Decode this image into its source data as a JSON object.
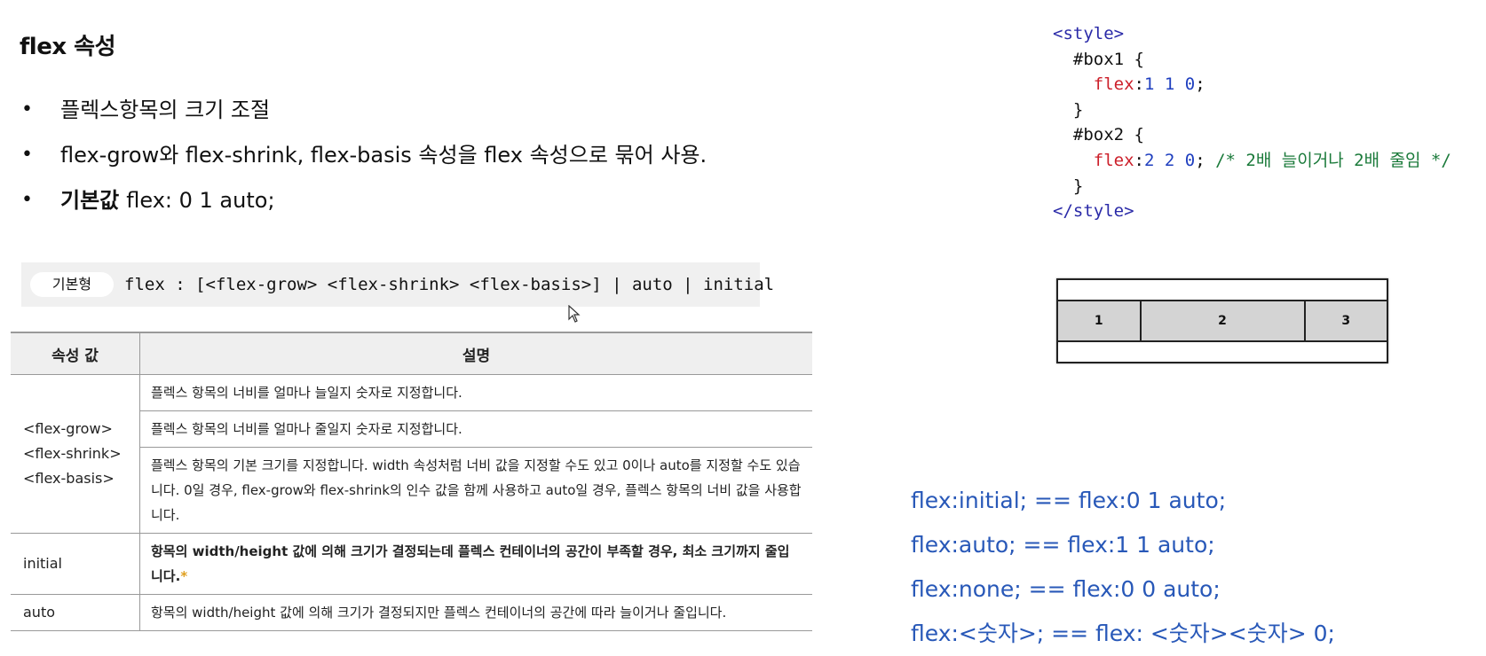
{
  "title": "flex 속성",
  "bullets": [
    {
      "dot": "•",
      "strong": "",
      "text": "플렉스항목의 크기 조절"
    },
    {
      "dot": "•",
      "strong": "",
      "text": "flex-grow와 flex-shrink, flex-basis 속성을 flex 속성으로 묶어 사용."
    },
    {
      "dot": "•",
      "strong": "기본값",
      "text": "flex: 0 1 auto;"
    }
  ],
  "syntax": {
    "label": "기본형",
    "code": "flex : [<flex-grow> <flex-shrink> <flex-basis>]  | auto | initial"
  },
  "table": {
    "headers": [
      "속성 값",
      "설명"
    ],
    "group_label_lines": [
      "<flex-grow>",
      "<flex-shrink>",
      "<flex-basis>"
    ],
    "group_rows": [
      "플렉스 항목의 너비를 얼마나 늘일지 숫자로 지정합니다.",
      "플렉스 항목의 너비를 얼마나 줄일지 숫자로 지정합니다.",
      "플렉스 항목의 기본 크기를 지정합니다. width 속성처럼 너비 값을 지정할 수도 있고 0이나 auto를 지정할 수도 있습니다. 0일 경우, flex-grow와 flex-shrink의 인수 값을 함께 사용하고 auto일 경우, 플렉스 항목의 너비 값을 사용합니다."
    ],
    "initial": {
      "label": "initial",
      "desc": "항목의 width/height 값에 의해 크기가 결정되는데 플렉스 컨테이너의 공간이 부족할 경우, 최소 크기까지 줄입니다.",
      "mark": "*"
    },
    "auto": {
      "label": "auto",
      "desc": "항목의 width/height 값에 의해 크기가 결정되지만 플렉스 컨테이너의 공간에 따라 늘이거나 줄입니다."
    }
  },
  "code": {
    "style_open": "<style>",
    "box1_sel": "#box1 {",
    "box1_prop": "flex",
    "box1_colon": ":",
    "box1_val": "1 1 0",
    "box1_semi": ";",
    "close1": "}",
    "box2_sel": "#box2 {",
    "box2_prop": "flex",
    "box2_colon": ":",
    "box2_val": "2 2 0",
    "box2_semi": ";",
    "box2_comment": "/* 2배 늘이거나 2배 줄임 */",
    "close2": "}",
    "style_close": "</style>"
  },
  "demo": {
    "cells": [
      "1",
      "2",
      "3"
    ],
    "flex": [
      1,
      2,
      1
    ]
  },
  "shorthands": [
    "flex:initial;  == flex:0 1 auto;",
    "flex:auto; == flex:1 1 auto;",
    "flex:none; == flex:0 0 auto;",
    "flex:<숫자>; == flex: <숫자><숫자> 0;"
  ],
  "colors": {
    "tag": "#2a2aa8",
    "property": "#cc1f2a",
    "number": "#1f3fbf",
    "comment": "#1a7a3a",
    "shorthand": "#2858b8",
    "star": "#e0a020"
  },
  "icons": {
    "cursor": "mouse-pointer-icon"
  }
}
